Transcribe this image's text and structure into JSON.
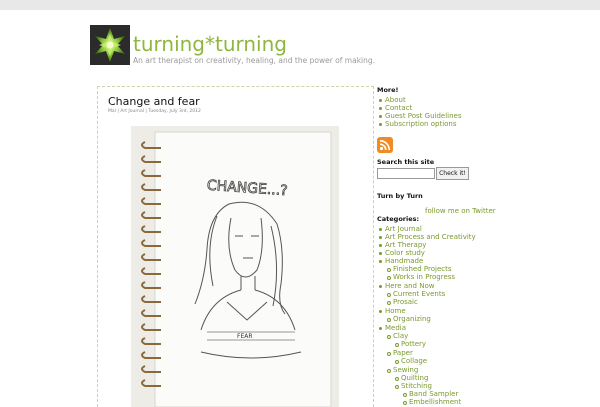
{
  "site": {
    "title": "turning*turning",
    "tagline": "An art therapist on creativity, healing, and the power of making."
  },
  "post": {
    "title": "Change and fear",
    "meta": "Mal | Art Journal | Tuesday, July 3rd, 2012",
    "image_text_top": "CHANGE...?",
    "image_text_shirt": "FEAR"
  },
  "sidebar": {
    "more_heading": "More!",
    "more_links": [
      "About",
      "Contact",
      "Guest Post Guidelines",
      "Subscription options"
    ],
    "search_heading": "Search this site",
    "search_button": "Check it!",
    "turn_heading": "Turn by Turn",
    "twitter_link": "follow me on Twitter",
    "categories_heading": "Categories:",
    "categories": [
      {
        "label": "Art Journal",
        "level": 0
      },
      {
        "label": "Art Process and Creativity",
        "level": 0
      },
      {
        "label": "Art Therapy",
        "level": 0
      },
      {
        "label": "Color study",
        "level": 0
      },
      {
        "label": "Handmade",
        "level": 0
      },
      {
        "label": "Finished Projects",
        "level": 1
      },
      {
        "label": "Works in Progress",
        "level": 1
      },
      {
        "label": "Here and Now",
        "level": 0
      },
      {
        "label": "Current Events",
        "level": 1
      },
      {
        "label": "Prosaic",
        "level": 1
      },
      {
        "label": "Home",
        "level": 0
      },
      {
        "label": "Organizing",
        "level": 1
      },
      {
        "label": "Media",
        "level": 0
      },
      {
        "label": "Clay",
        "level": 1
      },
      {
        "label": "Pottery",
        "level": 2
      },
      {
        "label": "Paper",
        "level": 1
      },
      {
        "label": "Collage",
        "level": 2
      },
      {
        "label": "Sewing",
        "level": 1
      },
      {
        "label": "Quilting",
        "level": 2
      },
      {
        "label": "Stitching",
        "level": 2
      },
      {
        "label": "Band Sampler",
        "level": 3
      },
      {
        "label": "Embellishment",
        "level": 3
      }
    ]
  },
  "colors": {
    "accent": "#8fb73e",
    "link": "#7a9a2e",
    "rss": "#f08a24"
  },
  "icons": {
    "logo": "green-flower-logo",
    "feed": "rss-icon"
  }
}
